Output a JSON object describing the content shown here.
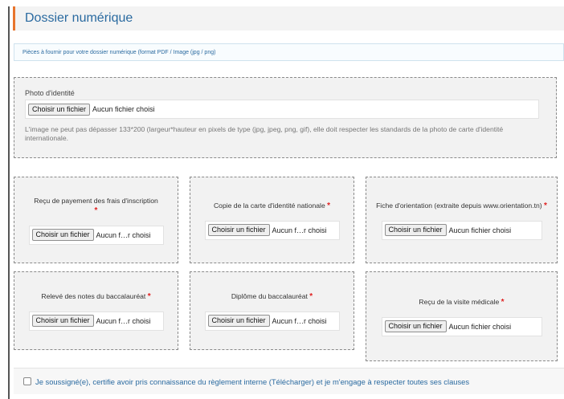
{
  "header": {
    "title": "Dossier numérique"
  },
  "info": {
    "text": "Pièces à fournir pour votre dossier numérique (format PDF / Image (jpg / png)"
  },
  "photo": {
    "label": "Photo d'identité",
    "button_label": "Choisir un fichier",
    "status": "Aucun fichier choisi",
    "note": "L'image ne peut pas dépasser 133*200 (largeur*hauteur en pixels de type (jpg, jpeg, png, gif), elle doit respecter les standards de la photo de carte d'identité internationale."
  },
  "documents": [
    {
      "label": "Reçu de payement des frais d'inscription",
      "required_mark": "*",
      "button_label": "Choisir un fichier",
      "status": "Aucun f…r choisi"
    },
    {
      "label": "Copie de la carte d'identité nationale",
      "required_mark": "*",
      "button_label": "Choisir un fichier",
      "status": "Aucun f…r choisi"
    },
    {
      "label": "Fiche d'orientation (extraite depuis www.orientation.tn)",
      "required_mark": "*",
      "button_label": "Choisir un fichier",
      "status": "Aucun fichier choisi"
    },
    {
      "label": "Relevé des notes du baccalauréat",
      "required_mark": "*",
      "button_label": "Choisir un fichier",
      "status": "Aucun f…r choisi"
    },
    {
      "label": "Diplôme du baccalauréat",
      "required_mark": "*",
      "button_label": "Choisir un fichier",
      "status": "Aucun f…r choisi"
    },
    {
      "label": "Reçu de la visite médicale",
      "required_mark": "*",
      "button_label": "Choisir un fichier",
      "status": "Aucun fichier choisi"
    }
  ],
  "terms": {
    "text": "Je soussigné(e), certifie avoir pris connaissance du règlement interne (Télécharger) et je m'engage à respecter toutes ses clauses"
  },
  "colors": {
    "accent": "#e8742c",
    "title_blue": "#2a6aa0",
    "required_red": "#e02020"
  }
}
